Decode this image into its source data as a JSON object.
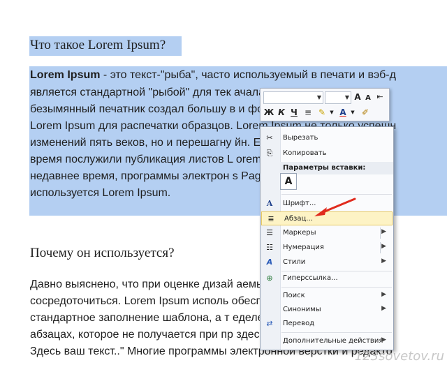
{
  "document": {
    "heading1": "Что такое Lorem Ipsum?",
    "heading1_underlined": "Lorem Ipsum",
    "para1": [
      {
        "bold": "Lorem Ipsum",
        "text": " - это текст-\"рыба\", часто используемый в печати и вэб-д"
      },
      {
        "bold": "",
        "text": "является стандартной \"рыбой\" для тек                                    ачала XVI"
      },
      {
        "bold": "",
        "text": "безымянный печатник создал большу                              в и форм"
      },
      {
        "bold": "",
        "text": "Lorem Ipsum для распечатки образцов. Lorem Ipsum не только успешн"
      },
      {
        "bold": "",
        "text": "изменений пять веков, но и перешагну                              йн. Его по"
      },
      {
        "bold": "",
        "text": "время послужили публикация листов L                              orem Ipsu"
      },
      {
        "bold": "",
        "text": "недавнее время, программы электрон                                s PageMa"
      },
      {
        "bold": "",
        "text": "используется Lorem Ipsum."
      }
    ],
    "heading2": "Почему он используется?",
    "para2": [
      "Давно выяснено, что при оценке дизай                                    аемый текс",
      "сосредоточиться. Lorem Ipsum исполь                                    обеспечив",
      "стандартное заполнение шаблона, а т                                    еделение",
      "абзацах, которое не получается при пр                                    здесь ваш",
      "Здесь ваш текст..\" Многие программы электронной верстки и редакто"
    ],
    "watermark": "123sovetov.ru"
  },
  "mini_toolbar": {
    "font_name": "",
    "font_size": "",
    "grow_font": "A",
    "shrink_font": "A",
    "bold": "Ж",
    "italic": "К",
    "underline": "Ч",
    "font_color": "A"
  },
  "context_menu": {
    "items": [
      {
        "label": "Вырезать",
        "icon": "scissors-icon",
        "glyph": "✂"
      },
      {
        "label": "Копировать",
        "icon": "copy-icon",
        "glyph": "⎘"
      },
      {
        "label": "Параметры вставки:",
        "icon": "",
        "glyph": ""
      },
      {
        "label": "Шрифт...",
        "icon": "font-icon",
        "glyph": "A"
      },
      {
        "label": "Абзац...",
        "icon": "paragraph-icon",
        "glyph": "≣"
      },
      {
        "label": "Маркеры",
        "icon": "bullets-icon",
        "glyph": "☰"
      },
      {
        "label": "Нумерация",
        "icon": "numbering-icon",
        "glyph": "☷"
      },
      {
        "label": "Стили",
        "icon": "styles-icon",
        "glyph": "A"
      },
      {
        "label": "Гиперссылка...",
        "icon": "hyperlink-icon",
        "glyph": "⊕"
      },
      {
        "label": "Поиск",
        "icon": "",
        "glyph": ""
      },
      {
        "label": "Синонимы",
        "icon": "",
        "glyph": ""
      },
      {
        "label": "Перевод",
        "icon": "translate-icon",
        "glyph": "⇄"
      },
      {
        "label": "Дополнительные действия",
        "icon": "",
        "glyph": ""
      }
    ],
    "paste_option": "A",
    "submenu_arrow": "▶"
  },
  "colors": {
    "selection": "#b4cff2",
    "highlight": "#fdf3c5",
    "arrow": "#e02b1e"
  }
}
